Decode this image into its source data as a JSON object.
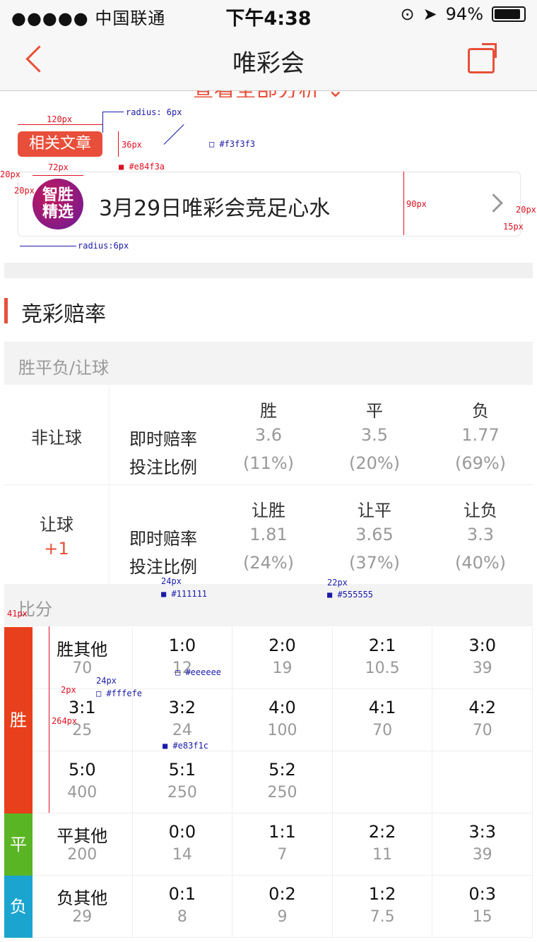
{
  "status_bar": {
    "carrier": "●●●●● 中国联通",
    "time": "下午4:38",
    "battery": "94%"
  },
  "nav": {
    "title": "唯彩会"
  },
  "clipped_link": "查看全部分析 ⌄",
  "article": {
    "tag": "相关文章",
    "logo_text": "智胜\n精选",
    "title": "3月29日唯彩会竞足心水"
  },
  "section": {
    "title": "竞彩赔率",
    "subheader": "胜平负/让球",
    "score_header": "比分"
  },
  "odds": [
    {
      "type": "非让球",
      "handicap": "",
      "headers": [
        "胜",
        "平",
        "负"
      ],
      "label_rate": "即时赔率",
      "label_ratio": "投注比例",
      "rates": [
        "3.6",
        "3.5",
        "1.77"
      ],
      "ratios": [
        "(11%)",
        "(20%)",
        "(69%)"
      ]
    },
    {
      "type": "让球",
      "handicap": "+1",
      "headers": [
        "让胜",
        "让平",
        "让负"
      ],
      "label_rate": "即时赔率",
      "label_ratio": "投注比例",
      "rates": [
        "1.81",
        "3.65",
        "3.3"
      ],
      "ratios": [
        "(24%)",
        "(37%)",
        "(40%)"
      ]
    }
  ],
  "score_groups": [
    {
      "label": "胜",
      "color": "#e83f1c",
      "rows": [
        [
          {
            "s": "胜其他",
            "o": "70"
          },
          {
            "s": "1:0",
            "o": "12"
          },
          {
            "s": "2:0",
            "o": "19"
          },
          {
            "s": "2:1",
            "o": "10.5"
          },
          {
            "s": "3:0",
            "o": "39"
          }
        ],
        [
          {
            "s": "3:1",
            "o": "25"
          },
          {
            "s": "3:2",
            "o": "24"
          },
          {
            "s": "4:0",
            "o": "100"
          },
          {
            "s": "4:1",
            "o": "70"
          },
          {
            "s": "4:2",
            "o": "70"
          }
        ],
        [
          {
            "s": "5:0",
            "o": "400"
          },
          {
            "s": "5:1",
            "o": "250"
          },
          {
            "s": "5:2",
            "o": "250"
          },
          {
            "s": "",
            "o": ""
          },
          {
            "s": "",
            "o": ""
          }
        ]
      ]
    },
    {
      "label": "平",
      "color": "#5ab524",
      "rows": [
        [
          {
            "s": "平其他",
            "o": "200"
          },
          {
            "s": "0:0",
            "o": "14"
          },
          {
            "s": "1:1",
            "o": "7"
          },
          {
            "s": "2:2",
            "o": "11"
          },
          {
            "s": "3:3",
            "o": "39"
          }
        ]
      ]
    },
    {
      "label": "负",
      "color": "#1aa4cf",
      "rows": [
        [
          {
            "s": "负其他",
            "o": "29"
          },
          {
            "s": "0:1",
            "o": "8"
          },
          {
            "s": "0:2",
            "o": "9"
          },
          {
            "s": "1:2",
            "o": "7.5"
          },
          {
            "s": "0:3",
            "o": "15"
          }
        ]
      ]
    }
  ],
  "annotations": {
    "w120": "120px",
    "radius6": "radius: 6px",
    "h36": "36px",
    "c_f3": "□ #f3f3f3",
    "c_e84": "■ #e84f3a",
    "w20a": "20px",
    "w72": "72px",
    "w20b": "20px",
    "h90": "90px",
    "w20c": "20px",
    "w15": "15px",
    "radius6b": "radius:6px",
    "fs24a": "24px",
    "c_111": "■ #111111",
    "fs22": "22px",
    "c_555": "■ #555555",
    "w41": "41px",
    "fs24b": "24px",
    "c_eee": "□ #eeeeee",
    "p2": "2px",
    "c_fff": "□ #fffefe",
    "h264": "264px",
    "c_e83": "■ #e83f1c"
  }
}
